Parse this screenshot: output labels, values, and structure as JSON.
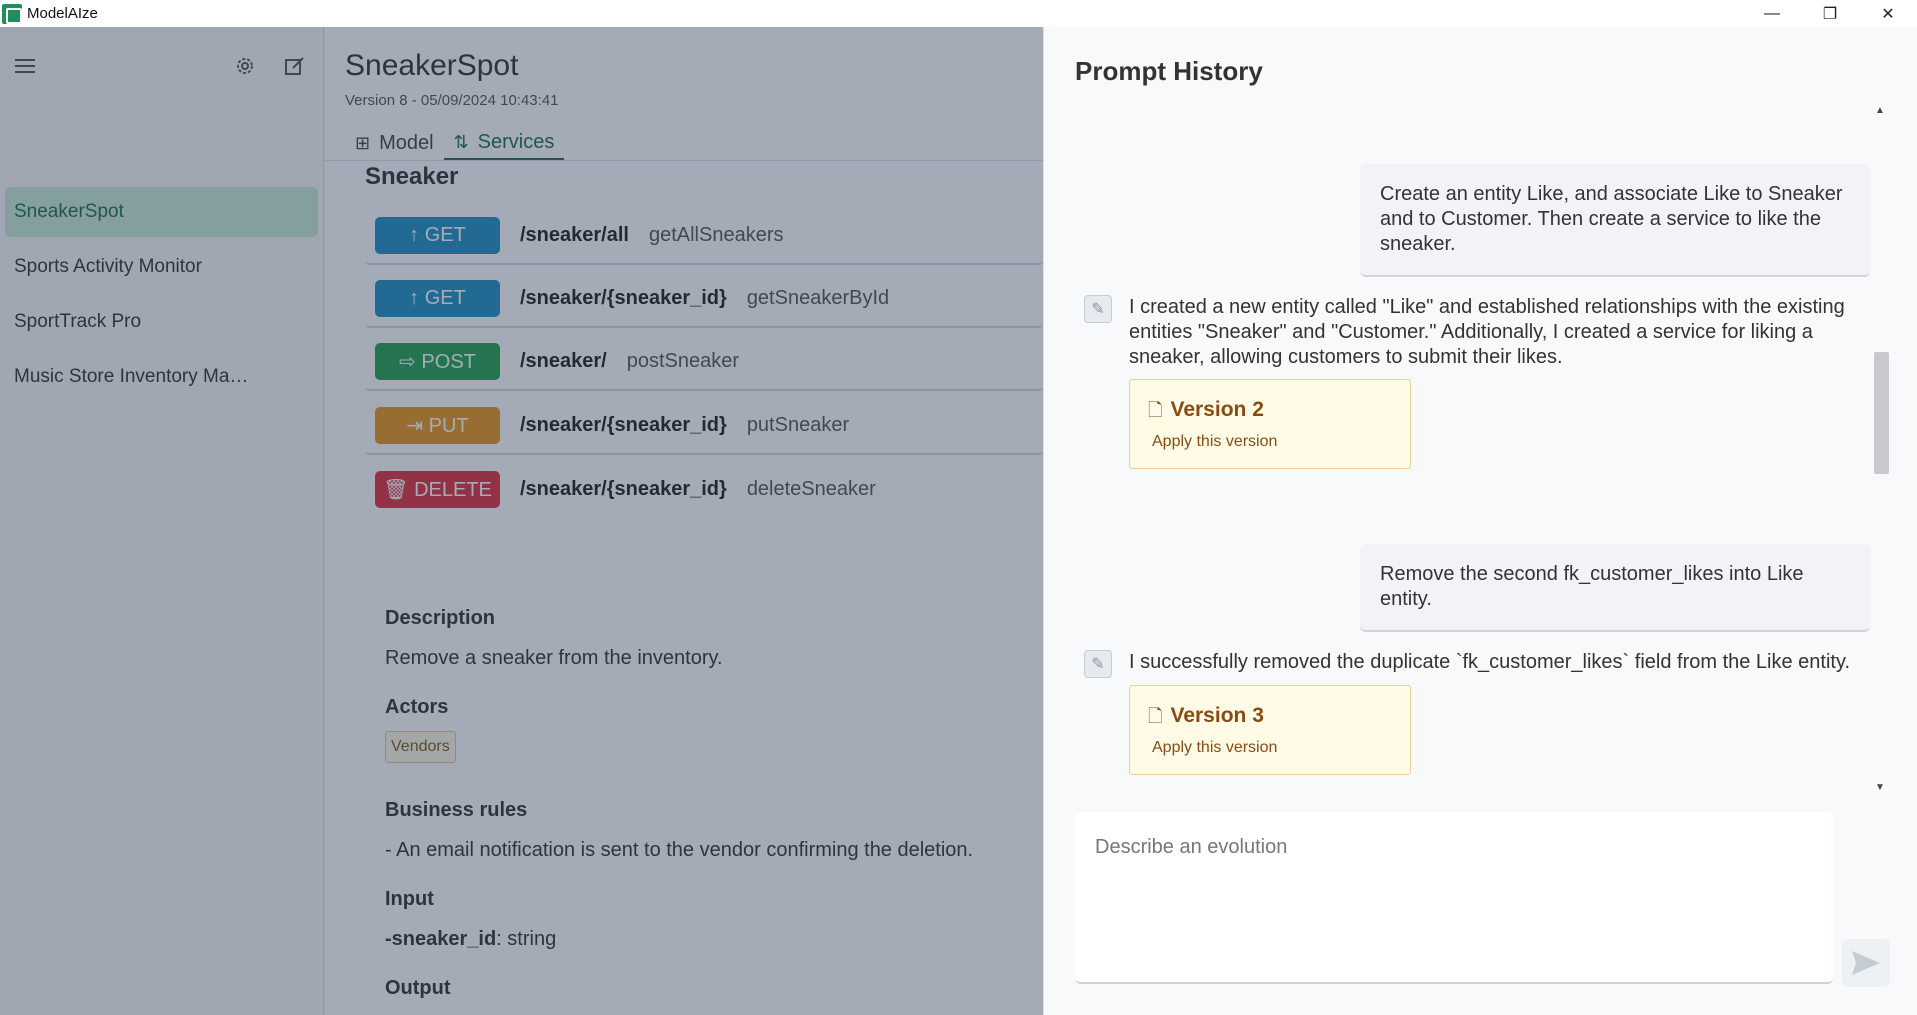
{
  "window": {
    "title": "ModelAIze",
    "minimize": "—",
    "maximize": "❐",
    "close": "✕"
  },
  "sidebar": {
    "menu_icon": "hamburger-icon",
    "settings_icon": "gear-icon",
    "new_icon": "edit-icon",
    "items": [
      {
        "label": "SneakerSpot",
        "active": true
      },
      {
        "label": "Sports Activity Monitor"
      },
      {
        "label": "SportTrack Pro"
      },
      {
        "label": "Music Store Inventory Ma…"
      }
    ]
  },
  "project": {
    "title": "SneakerSpot",
    "version": "Version 8 - 05/09/2024 10:43:41",
    "tabs": [
      {
        "label": "Model",
        "icon": "grid-icon"
      },
      {
        "label": "Services",
        "icon": "arrows-icon",
        "active": true
      }
    ],
    "entity": "Sneaker",
    "endpoints": [
      {
        "method": "↑ GET",
        "path": "/sneaker/all",
        "op": "getAllSneakers"
      },
      {
        "method": "↑ GET",
        "path": "/sneaker/{sneaker_id}",
        "op": "getSneakerById"
      },
      {
        "method": "⇨ POST",
        "path": "/sneaker/",
        "op": "postSneaker"
      },
      {
        "method": "⇥ PUT",
        "path": "/sneaker/{sneaker_id}",
        "op": "putSneaker"
      },
      {
        "method": "🗑 DELETE",
        "path": "/sneaker/{sneaker_id}",
        "op": "deleteSneaker"
      }
    ],
    "details": {
      "description_h": "Description",
      "description": "Remove a sneaker from the inventory.",
      "actors_h": "Actors",
      "actor": "Vendors",
      "rules_h": "Business rules",
      "rule": "- An email notification is sent to the vendor confirming the deletion.",
      "input_h": "Input",
      "input_name": "-sneaker_id",
      "input_type": ": string",
      "output_h": "Output"
    }
  },
  "history": {
    "title": "Prompt History",
    "messages": [
      {
        "role": "user",
        "text": "Create an entity Like, and associate Like to Sneaker and to Customer. Then create a service to like the sneaker."
      },
      {
        "role": "ai",
        "text": "I created a new entity called \"Like\" and established relationships with the existing entities \"Sneaker\" and \"Customer.\" Additionally, I created a service for liking a sneaker, allowing customers to submit their likes.",
        "version": "Version 2",
        "apply": "Apply this version"
      },
      {
        "role": "user",
        "text": "Remove the second fk_customer_likes into Like entity."
      },
      {
        "role": "ai",
        "text": "I successfully removed the duplicate `fk_customer_likes` field from the Like entity.",
        "version": "Version 3",
        "apply": "Apply this version"
      }
    ],
    "compose_placeholder": "Describe an evolution",
    "send_icon": "send-icon"
  }
}
